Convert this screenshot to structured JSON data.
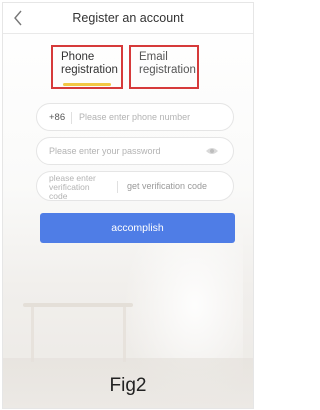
{
  "header": {
    "title": "Register an account",
    "back_icon": "chevron-left-icon"
  },
  "tabs": [
    {
      "label": "Phone registration",
      "active": true
    },
    {
      "label": "Email registration",
      "active": false
    }
  ],
  "form": {
    "country_code": "+86",
    "phone_placeholder": "Please enter phone number",
    "password_placeholder": "Please enter your password",
    "password_toggle_icon": "eye-icon",
    "code_placeholder": "please enter verification code",
    "get_code_label": "get verification code",
    "submit_label": "accomplish"
  },
  "caption": "Fig2",
  "colors": {
    "accent": "#4f7de6",
    "tab_highlight": "#d63a3a",
    "active_underline": "#f2c744"
  }
}
